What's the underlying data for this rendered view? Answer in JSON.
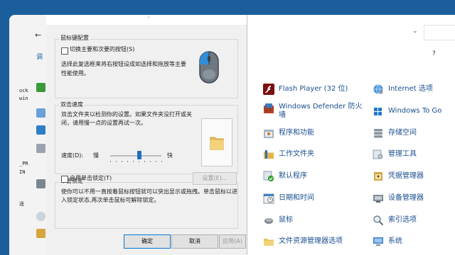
{
  "left_strip": {
    "back_glyph": "←",
    "nav_text": "调",
    "labels": [
      "ock",
      "win",
      "_PR",
      "IN",
      "适"
    ]
  },
  "dialog": {
    "buttons_group": {
      "title": "鼠标键配置",
      "swap_checkbox_label": "切换主要和次要的按钮(S)",
      "swap_checked": false,
      "description": [
        "选择此复选框来将右按钮设成如选择和拖放等主要",
        "性能使用。"
      ]
    },
    "speed_group": {
      "title": "双击速度",
      "description": [
        "双击文件夹以检测你的设置。如果文件夹没打开或关",
        "闭，请用慢一点的设置再试一次。"
      ],
      "speed_label": "速度(D):",
      "slow_label": "慢",
      "fast_label": "快",
      "speed_value_fraction": 0.57
    },
    "clicklock_group": {
      "title": "单击锁定",
      "enable_label": "启用单击锁定(T)",
      "enable_checked": false,
      "settings_button": "设置(E)...",
      "description": [
        "使你可以不用一直按着鼠标按钮就可以突出显示或拖拽。单击鼠标以进",
        "入锁定状态,再次单击鼠标可解除锁定。"
      ]
    },
    "footer": {
      "ok": "确定",
      "cancel": "取消",
      "apply": "应用(A)"
    }
  },
  "control_panel": {
    "items_col1": [
      {
        "label": "Flash Player (32 位)",
        "icon": "flash-icon"
      },
      {
        "label": "Windows Defender 防火",
        "label2": "墙",
        "icon": "firewall-icon"
      },
      {
        "label": "程序和功能",
        "icon": "programs-icon"
      },
      {
        "label": "工作文件夹",
        "icon": "work-folders-icon"
      },
      {
        "label": "默认程序",
        "icon": "default-programs-icon"
      },
      {
        "label": "日期和时间",
        "icon": "date-time-icon"
      },
      {
        "label": "鼠标",
        "icon": "mouse-icon"
      },
      {
        "label": "文件资源管理器选项",
        "icon": "explorer-options-icon"
      }
    ],
    "items_col2": [
      {
        "label": "Internet 选项",
        "icon": "internet-options-icon"
      },
      {
        "label": "Windows To Go",
        "icon": "windows-to-go-icon"
      },
      {
        "label": "存储空间",
        "icon": "storage-icon"
      },
      {
        "label": "管理工具",
        "icon": "admin-tools-icon"
      },
      {
        "label": "凭据管理器",
        "icon": "credential-icon"
      },
      {
        "label": "设备管理器",
        "icon": "device-manager-icon"
      },
      {
        "label": "索引选项",
        "icon": "indexing-icon"
      },
      {
        "label": "系统",
        "icon": "system-icon"
      }
    ]
  },
  "colors": {
    "frame": "#1a5f9c",
    "link": "#1a4f8f",
    "accent": "#0078d7"
  }
}
